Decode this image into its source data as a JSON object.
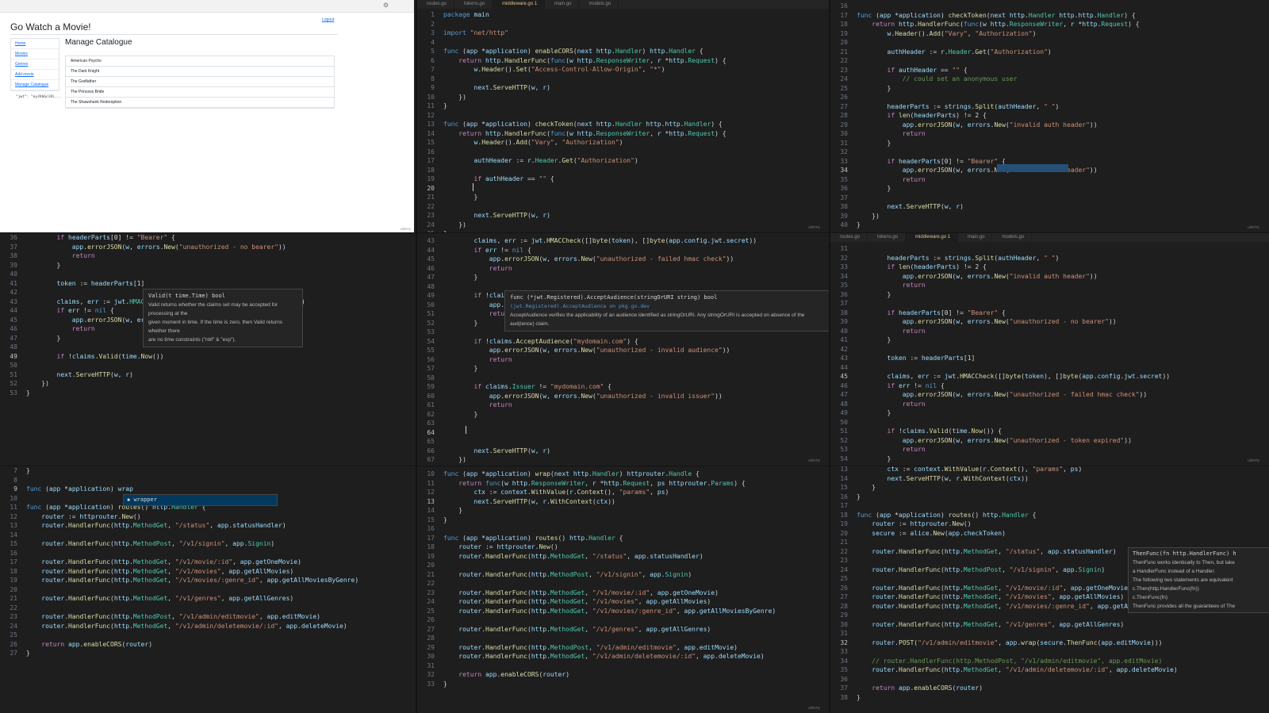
{
  "browser": {
    "settings_icon": "gear-icon",
    "title": "Go Watch a Movie!",
    "logout": "Logout",
    "nav": [
      "Home",
      "Movies",
      "Genres",
      "Add movie",
      "Manage Catalogue"
    ],
    "jwt_text": "\"jwt\": \"eyJhbGciOi...",
    "heading": "Manage Catalogue",
    "movies": [
      "American Psycho",
      "The Dark Knight",
      "The Godfather",
      "The Princess Bride",
      "The Shawshank Redemption"
    ]
  },
  "tabs": {
    "top": [
      "routes.go",
      "tokens.go",
      "middleware.go 1",
      "main.go",
      "models.go"
    ],
    "middle_right": [
      "routes.go",
      "tokens.go",
      "middleware.go 1",
      "main.go",
      "models.go"
    ],
    "active_index": 2
  },
  "watermark": "udemy",
  "panels": [
    {
      "id": "p2",
      "lines": [
        [
          "1",
          "package main"
        ],
        [
          "2",
          ""
        ],
        [
          "3",
          "import \"net/http\""
        ],
        [
          "4",
          ""
        ],
        [
          "5",
          "func (app *application) enableCORS(next http.Handler) http.Handler {"
        ],
        [
          "6",
          "    return http.HandlerFunc(func(w http.ResponseWriter, r *http.Request) {"
        ],
        [
          "7",
          "        w.Header().Set(\"Access-Control-Allow-Origin\", \"*\")"
        ],
        [
          "8",
          ""
        ],
        [
          "9",
          "        next.ServeHTTP(w, r)"
        ],
        [
          "10",
          "    })"
        ],
        [
          "11",
          "}"
        ],
        [
          "12",
          ""
        ],
        [
          "13",
          "func (app *application) checkToken(next http.Handler http.http.Handler) {"
        ],
        [
          "14",
          "    return http.HandlerFunc(func(w http.ResponseWriter, r *http.Request) {"
        ],
        [
          "15",
          "        w.Header().Add(\"Vary\", \"Authorization\")"
        ],
        [
          "16",
          ""
        ],
        [
          "17",
          "        authHeader := r.Header.Get(\"Authorization\")"
        ],
        [
          "18",
          ""
        ],
        [
          "19",
          "        if authHeader == \"\" {"
        ],
        [
          "20",
          ""
        ],
        [
          "21",
          "        }"
        ],
        [
          "22",
          ""
        ],
        [
          "23",
          "        next.ServeHTTP(w, r)"
        ],
        [
          "24",
          "    })"
        ],
        [
          "25",
          "}"
        ]
      ]
    },
    {
      "id": "p3",
      "lines": [
        [
          "16",
          ""
        ],
        [
          "17",
          "func (app *application) checkToken(next http.Handler http.http.Handler) {"
        ],
        [
          "18",
          "    return http.HandlerFunc(func(w http.ResponseWriter, r *http.Request) {"
        ],
        [
          "19",
          "        w.Header().Add(\"Vary\", \"Authorization\")"
        ],
        [
          "20",
          ""
        ],
        [
          "21",
          "        authHeader := r.Header.Get(\"Authorization\")"
        ],
        [
          "22",
          ""
        ],
        [
          "23",
          "        if authHeader == \"\" {"
        ],
        [
          "24",
          "            // could set an anonymous user"
        ],
        [
          "25",
          "        }"
        ],
        [
          "26",
          ""
        ],
        [
          "27",
          "        headerParts := strings.Split(authHeader, \" \")"
        ],
        [
          "28",
          "        if len(headerParts) != 2 {"
        ],
        [
          "29",
          "            app.errorJSON(w, errors.New(\"invalid auth header\"))"
        ],
        [
          "30",
          "            return"
        ],
        [
          "31",
          "        }"
        ],
        [
          "32",
          ""
        ],
        [
          "33",
          "        if headerParts[0] != \"Bearer\" {"
        ],
        [
          "34",
          "            app.errorJSON(w, errors.New(\"invalid auth header\"))"
        ],
        [
          "35",
          "            return"
        ],
        [
          "36",
          "        }"
        ],
        [
          "37",
          ""
        ],
        [
          "38",
          "        next.ServeHTTP(w, r)"
        ],
        [
          "39",
          "    })"
        ],
        [
          "40",
          "}"
        ]
      ]
    },
    {
      "id": "p4",
      "lines": [
        [
          "36",
          "        if headerParts[0] != \"Bearer\" {"
        ],
        [
          "37",
          "            app.errorJSON(w, errors.New(\"unauthorized - no bearer\"))"
        ],
        [
          "38",
          "            return"
        ],
        [
          "39",
          "        }"
        ],
        [
          "40",
          ""
        ],
        [
          "41",
          "        token := headerParts[1]"
        ],
        [
          "42",
          ""
        ],
        [
          "43",
          "        claims, err := jwt.HMACChec                                    ))"
        ],
        [
          "44",
          "        if err != nil {"
        ],
        [
          "45",
          "            app.errorJSON(w, errors"
        ],
        [
          "46",
          "            return"
        ],
        [
          "47",
          "        }"
        ],
        [
          "48",
          ""
        ],
        [
          "49",
          "        if !claims.Valid(time.Now())"
        ],
        [
          "50",
          ""
        ],
        [
          "51",
          "        next.ServeHTTP(w, r)"
        ],
        [
          "52",
          "    })"
        ],
        [
          "53",
          "}"
        ]
      ]
    },
    {
      "id": "p5",
      "lines": [
        [
          "43",
          "        claims, err := jwt.HMACCheck([]byte(token), []byte(app.config.jwt.secret))"
        ],
        [
          "44",
          "        if err != nil {"
        ],
        [
          "45",
          "            app.errorJSON(w, errors.New(\"unauthorized - failed hmac check\"))"
        ],
        [
          "46",
          "            return"
        ],
        [
          "47",
          "        }"
        ],
        [
          "48",
          ""
        ],
        [
          "49",
          "        if !claims."
        ],
        [
          "50",
          "            app.err"
        ],
        [
          "51",
          "            return"
        ],
        [
          "52",
          "        }"
        ],
        [
          "53",
          ""
        ],
        [
          "54",
          "        if !claims.AcceptAudience(\"mydomain.com\") {"
        ],
        [
          "55",
          "            app.errorJSON(w, errors.New(\"unauthorized - invalid audience\"))"
        ],
        [
          "56",
          "            return"
        ],
        [
          "57",
          "        }"
        ],
        [
          "58",
          ""
        ],
        [
          "59",
          "        if claims.Issuer != \"mydomain.com\" {"
        ],
        [
          "60",
          "            app.errorJSON(w, errors.New(\"unauthorized - invalid issuer\"))"
        ],
        [
          "61",
          "            return"
        ],
        [
          "62",
          "        }"
        ],
        [
          "63",
          ""
        ],
        [
          "64",
          ""
        ],
        [
          "65",
          ""
        ],
        [
          "66",
          "        next.ServeHTTP(w, r)"
        ],
        [
          "67",
          "    })"
        ]
      ]
    },
    {
      "id": "p6",
      "lines": [
        [
          "31",
          ""
        ],
        [
          "32",
          "        headerParts := strings.Split(authHeader, \" \")"
        ],
        [
          "33",
          "        if len(headerParts) != 2 {"
        ],
        [
          "34",
          "            app.errorJSON(w, errors.New(\"invalid auth header\"))"
        ],
        [
          "35",
          "            return"
        ],
        [
          "36",
          "        }"
        ],
        [
          "37",
          ""
        ],
        [
          "38",
          "        if headerParts[0] != \"Bearer\" {"
        ],
        [
          "39",
          "            app.errorJSON(w, errors.New(\"unauthorized - no bearer\"))"
        ],
        [
          "40",
          "            return"
        ],
        [
          "41",
          "        }"
        ],
        [
          "42",
          ""
        ],
        [
          "43",
          "        token := headerParts[1]"
        ],
        [
          "44",
          ""
        ],
        [
          "45",
          "        claims, err := jwt.HMACCheck([]byte(token), []byte(app.config.jwt.secret))"
        ],
        [
          "46",
          "        if err != nil {"
        ],
        [
          "47",
          "            app.errorJSON(w, errors.New(\"unauthorized - failed hmac check\"))"
        ],
        [
          "48",
          "            return"
        ],
        [
          "49",
          "        }"
        ],
        [
          "50",
          ""
        ],
        [
          "51",
          "        if !claims.Valid(time.Now()) {"
        ],
        [
          "52",
          "            app.errorJSON(w, errors.New(\"unauthorized - token expired\"))"
        ],
        [
          "53",
          "            return"
        ],
        [
          "54",
          "        }"
        ]
      ]
    },
    {
      "id": "p7",
      "lines": [
        [
          "7",
          "}"
        ],
        [
          "8",
          ""
        ],
        [
          "9",
          "func (app *application) wrap"
        ],
        [
          "10",
          ""
        ],
        [
          "11",
          "func (app *application) routes() http.Handler {"
        ],
        [
          "12",
          "    router := httprouter.New()"
        ],
        [
          "13",
          "    router.HandlerFunc(http.MethodGet, \"/status\", app.statusHandler)"
        ],
        [
          "14",
          ""
        ],
        [
          "15",
          "    router.HandlerFunc(http.MethodPost, \"/v1/signin\", app.Signin)"
        ],
        [
          "16",
          ""
        ],
        [
          "17",
          "    router.HandlerFunc(http.MethodGet, \"/v1/movie/:id\", app.getOneMovie)"
        ],
        [
          "18",
          "    router.HandlerFunc(http.MethodGet, \"/v1/movies\", app.getAllMovies)"
        ],
        [
          "19",
          "    router.HandlerFunc(http.MethodGet, \"/v1/movies/:genre_id\", app.getAllMoviesByGenre)"
        ],
        [
          "20",
          ""
        ],
        [
          "21",
          "    router.HandlerFunc(http.MethodGet, \"/v1/genres\", app.getAllGenres)"
        ],
        [
          "22",
          ""
        ],
        [
          "23",
          "    router.HandlerFunc(http.MethodPost, \"/v1/admin/editmovie\", app.editMovie)"
        ],
        [
          "24",
          "    router.HandlerFunc(http.MethodGet, \"/v1/admin/deletemovie/:id\", app.deleteMovie)"
        ],
        [
          "25",
          ""
        ],
        [
          "26",
          "    return app.enableCORS(router)"
        ],
        [
          "27",
          "}"
        ]
      ]
    },
    {
      "id": "p8",
      "lines": [
        [
          "10",
          "func (app *application) wrap(next http.Handler) httprouter.Handle {"
        ],
        [
          "11",
          "    return func(w http.ResponseWriter, r *http.Request, ps httprouter.Params) {"
        ],
        [
          "12",
          "        ctx := context.WithValue(r.Context(), \"params\", ps)"
        ],
        [
          "13",
          "        next.ServeHTTP(w, r.WithContext(ctx))"
        ],
        [
          "14",
          "    }"
        ],
        [
          "15",
          "}"
        ],
        [
          "16",
          ""
        ],
        [
          "17",
          "func (app *application) routes() http.Handler {"
        ],
        [
          "18",
          "    router := httprouter.New()"
        ],
        [
          "19",
          "    router.HandlerFunc(http.MethodGet, \"/status\", app.statusHandler)"
        ],
        [
          "20",
          ""
        ],
        [
          "21",
          "    router.HandlerFunc(http.MethodPost, \"/v1/signin\", app.Signin)"
        ],
        [
          "22",
          ""
        ],
        [
          "23",
          "    router.HandlerFunc(http.MethodGet, \"/v1/movie/:id\", app.getOneMovie)"
        ],
        [
          "24",
          "    router.HandlerFunc(http.MethodGet, \"/v1/movies\", app.getAllMovies)"
        ],
        [
          "25",
          "    router.HandlerFunc(http.MethodGet, \"/v1/movies/:genre_id\", app.getAllMoviesByGenre)"
        ],
        [
          "26",
          ""
        ],
        [
          "27",
          "    router.HandlerFunc(http.MethodGet, \"/v1/genres\", app.getAllGenres)"
        ],
        [
          "28",
          ""
        ],
        [
          "29",
          "    router.HandlerFunc(http.MethodPost, \"/v1/admin/editmovie\", app.editMovie)"
        ],
        [
          "30",
          "    router.HandlerFunc(http.MethodGet, \"/v1/admin/deletemovie/:id\", app.deleteMovie)"
        ],
        [
          "31",
          ""
        ],
        [
          "32",
          "    return app.enableCORS(router)"
        ],
        [
          "33",
          "}"
        ]
      ]
    },
    {
      "id": "p9",
      "lines": [
        [
          "13",
          "        ctx := context.WithValue(r.Context(), \"params\", ps)"
        ],
        [
          "14",
          "        next.ServeHTTP(w, r.WithContext(ctx))"
        ],
        [
          "15",
          "    }"
        ],
        [
          "16",
          "}"
        ],
        [
          "17",
          ""
        ],
        [
          "18",
          "func (app *application) routes() http.Handler {"
        ],
        [
          "19",
          "    router := httprouter.New()"
        ],
        [
          "20",
          "    secure := alice.New(app.checkToken)"
        ],
        [
          "21",
          ""
        ],
        [
          "22",
          "    router.HandlerFunc(http.MethodGet, \"/status\", app.statusHandler)"
        ],
        [
          "23",
          ""
        ],
        [
          "24",
          "    router.HandlerFunc(http.MethodPost, \"/v1/signin\", app.Signin)"
        ],
        [
          "25",
          ""
        ],
        [
          "26",
          "    router.HandlerFunc(http.MethodGet, \"/v1/movie/:id\", app.getOneMovie)"
        ],
        [
          "27",
          "    router.HandlerFunc(http.MethodGet, \"/v1/movies\", app.getAllMovies)"
        ],
        [
          "28",
          "    router.HandlerFunc(http.MethodGet, \"/v1/movies/:genre_id\", app.getAllMovi"
        ],
        [
          "29",
          ""
        ],
        [
          "30",
          "    router.HandlerFunc(http.MethodGet, \"/v1/genres\", app.getAllGenres)"
        ],
        [
          "31",
          ""
        ],
        [
          "32",
          "    router.POST(\"/v1/admin/editmovie\", app.wrap(secure.ThenFunc(app.editMovie)))"
        ],
        [
          "33",
          ""
        ],
        [
          "34",
          "    // router.HandlerFunc(http.MethodPost, \"/v1/admin/editmovie\", app.editMovie)"
        ],
        [
          "35",
          "    router.HandlerFunc(http.MethodGet, \"/v1/admin/deletemovie/:id\", app.deleteMovie)"
        ],
        [
          "36",
          ""
        ],
        [
          "37",
          "    return app.enableCORS(router)"
        ],
        [
          "38",
          "}"
        ]
      ]
    }
  ],
  "hovers": {
    "valid": {
      "sig": "Valid(t time.Time) bool",
      "doc1": "Valid returns whether the claims set may be accepted for processing at the",
      "doc2": "given moment in time. If the time is zero, then Valid returns whether there",
      "doc3": "are no time constraints (\"nbf\" & \"exp\")."
    },
    "accept": {
      "sig": "func (*jwt.Registered).AcceptAudience(stringOrURI string) bool",
      "link": "(jwt.Registered).AcceptAudience on pkg.go.dev",
      "doc": "AcceptAudience verifies the applicability of an audience identified as stringOrURI. Any stringOrURI is accepted on absence of the aud(ience) claim."
    },
    "then": {
      "sig": "ThenFunc(fn http.HandlerFunc) h",
      "doc1": "ThenFunc works identically to Then, but take",
      "doc2": "a HandlerFunc instead of a Handler.",
      "doc3": "The following two statements are equivalent",
      "code1": "c.Then(http.HandlerFunc(fn))",
      "code2": "c.ThenFunc(fn)",
      "doc4": "ThenFunc provides all the guarantees of The"
    },
    "suggest": "wrapper",
    "suggest_icon": "symbol-icon"
  },
  "colors": {
    "keyword": "#569cd6",
    "function": "#dcdcaa",
    "string": "#ce9178",
    "type": "#4ec9b0",
    "comment": "#6a9955",
    "control": "#c586c0"
  }
}
